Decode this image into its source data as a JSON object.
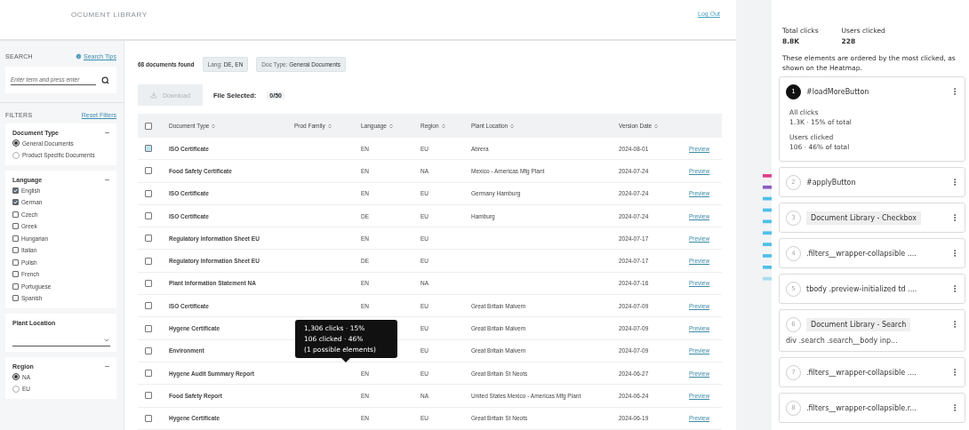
{
  "header": {
    "title": "OCUMENT LIBRARY",
    "logout": "Log Out"
  },
  "sidebar": {
    "search": {
      "label": "SEARCH",
      "tips": "Search Tips",
      "placeholder": "Enter term and press enter"
    },
    "filters": {
      "label": "FILTERS",
      "reset": "Reset Filters"
    },
    "groups": [
      {
        "kind": "radio",
        "title": "Document Type",
        "expanded": true,
        "options": [
          {
            "label": "General Documents",
            "selected": true
          },
          {
            "label": "Product Specific Documents",
            "selected": false
          }
        ]
      },
      {
        "kind": "checkbox",
        "title": "Language",
        "expanded": true,
        "options": [
          {
            "label": "English",
            "checked": true
          },
          {
            "label": "German",
            "checked": true
          },
          {
            "label": "Czech",
            "checked": false
          },
          {
            "label": "Greek",
            "checked": false
          },
          {
            "label": "Hungarian",
            "checked": false
          },
          {
            "label": "Italian",
            "checked": false
          },
          {
            "label": "Polish",
            "checked": false
          },
          {
            "label": "French",
            "checked": false
          },
          {
            "label": "Portuguese",
            "checked": false
          },
          {
            "label": "Spanish",
            "checked": false
          }
        ]
      },
      {
        "kind": "select",
        "title": "Plant Location",
        "expanded": false
      },
      {
        "kind": "radio",
        "title": "Region",
        "expanded": true,
        "options": [
          {
            "label": "NA",
            "selected": true
          },
          {
            "label": "EU",
            "selected": false
          }
        ]
      }
    ]
  },
  "main": {
    "found": "68 documents found",
    "chips": [
      {
        "label": "Lang:",
        "value": "DE, EN"
      },
      {
        "label": "Doc Type:",
        "value": "General Documents"
      }
    ],
    "download": {
      "label": "Download",
      "disabled": true
    },
    "selected_label": "File Selected:",
    "selected_count": "0/50",
    "table": {
      "select_all_checked": false,
      "columns": [
        "Document Type",
        "Prod Family",
        "Language",
        "Region",
        "Plant Location",
        "Version Date"
      ],
      "rows": [
        {
          "type": "ISO Certificate",
          "language": "EN",
          "region": "EU",
          "location": "Abrera",
          "date": "2024-08-01",
          "link": "Preview",
          "highlighted": true
        },
        {
          "type": "Food Safety Certificate",
          "language": "EN",
          "region": "NA",
          "location": "Mexico - Americas Mfg Plant",
          "date": "2024-07-24",
          "link": "Preview",
          "highlighted": false
        },
        {
          "type": "ISO Certificate",
          "language": "EN",
          "region": "EU",
          "location": "Germany Hamburg",
          "date": "2024-07-24",
          "link": "Preview",
          "highlighted": false
        },
        {
          "type": "ISO Certificate",
          "language": "DE",
          "region": "EU",
          "location": "Hamburg",
          "date": "2024-07-24",
          "link": "Preview",
          "highlighted": false
        },
        {
          "type": "Regulatory Information Sheet EU",
          "language": "EN",
          "region": "EU",
          "date": "2024-07-17",
          "link": "Preview",
          "highlighted": false
        },
        {
          "type": "Regulatory Information Sheet EU",
          "language": "DE",
          "region": "EU",
          "date": "2024-07-17",
          "link": "Preview",
          "highlighted": false
        },
        {
          "type": "Plant Information Statement NA",
          "language": "EN",
          "region": "NA",
          "date": "2024-07-16",
          "link": "Preview",
          "highlighted": false
        },
        {
          "type": "ISO Certificate",
          "language": "EN",
          "region": "EU",
          "location": "Great Britain Malvern",
          "date": "2024-07-09",
          "link": "Preview",
          "highlighted": false
        },
        {
          "type": "Hygene Certificate",
          "region": "EU",
          "location": "Great Britain Malvern",
          "date": "2024-07-09",
          "link": "Preview",
          "highlighted": false
        },
        {
          "type": "Environment",
          "region": "EU",
          "location": "Great Britain Malvern",
          "date": "2024-07-09",
          "link": "Preview",
          "highlighted": false
        },
        {
          "type": "Hygene Audit Summary Report",
          "language": "EN",
          "region": "EU",
          "location": "Great Britain St Neots",
          "date": "2024-06-27",
          "link": "Preview",
          "highlighted": false
        },
        {
          "type": "Food Safety Report",
          "language": "EN",
          "region": "NA",
          "location": "United States Mexico - Americas Mfg Plant",
          "date": "2024-06-24",
          "link": "Preview",
          "highlighted": false
        },
        {
          "type": "Hygene Certificate",
          "language": "EN",
          "region": "EU",
          "location": "Great Britain St Neots",
          "date": "2024-06-19",
          "link": "Preview",
          "highlighted": false
        }
      ]
    },
    "tooltip": [
      "1,306 clicks · 15%",
      "106 clicked · 46%",
      "(1 possible elements)"
    ]
  },
  "panel": {
    "stats": [
      {
        "label": "Total clicks",
        "value": "8.8K"
      },
      {
        "label": "Users clicked",
        "value": "228"
      }
    ],
    "note": "These elements are ordered by the most clicked, as shown on the Heatmap.",
    "elements": [
      {
        "rank": "1",
        "selected": true,
        "kind": "selector",
        "title": "#loadMoreButton",
        "details": [
          {
            "label": "All clicks",
            "value": "1.3K · 15% of total"
          },
          {
            "label": "Users clicked",
            "value": "106 · 46% of total"
          }
        ]
      },
      {
        "rank": "2",
        "selected": false,
        "kind": "selector",
        "title": "#applyButton"
      },
      {
        "rank": "3",
        "selected": false,
        "kind": "label",
        "title": "Document Library - Checkbox"
      },
      {
        "rank": "4",
        "selected": false,
        "kind": "selector",
        "title": ".filters__wrapper-collapsible ...."
      },
      {
        "rank": "5",
        "selected": false,
        "kind": "selector",
        "title": "tbody .preview-initialized td ...."
      },
      {
        "rank": "6",
        "selected": false,
        "kind": "label",
        "title": "Document Library - Search",
        "subtitle": "div .search .search__body inp..."
      },
      {
        "rank": "7",
        "selected": false,
        "kind": "selector",
        "title": ".filters__wrapper-collapsible ...."
      },
      {
        "rank": "8",
        "selected": false,
        "kind": "selector",
        "title": ".filters__wrapper-collapsible.r..."
      }
    ]
  }
}
